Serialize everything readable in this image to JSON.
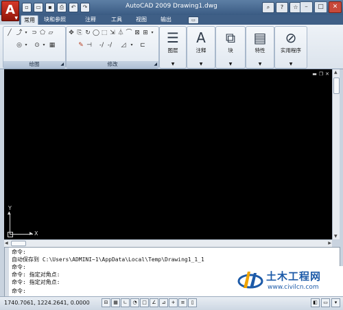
{
  "window": {
    "title": "AutoCAD 2009  Drawing1.dwg",
    "qat": [
      "new-icon",
      "open-icon",
      "save-icon",
      "print-icon",
      "undo-icon",
      "redo-icon"
    ],
    "title_tools": [
      "search-icon",
      "help-icon",
      "star-icon"
    ],
    "controls": [
      "minimize",
      "maximize",
      "close"
    ]
  },
  "tabs": [
    {
      "label": "常用",
      "active": true
    },
    {
      "label": "块和参照",
      "active": false
    },
    {
      "label": "注释",
      "active": false
    },
    {
      "label": "工具",
      "active": false
    },
    {
      "label": "视图",
      "active": false
    },
    {
      "label": "输出",
      "active": false
    }
  ],
  "ribbon": {
    "draw_title": "绘图",
    "modify_title": "修改",
    "big_panels": [
      {
        "label": "图层",
        "icon": "layers-icon"
      },
      {
        "label": "注释",
        "icon": "annotation-icon"
      },
      {
        "label": "块",
        "icon": "block-icon"
      },
      {
        "label": "特性",
        "icon": "properties-icon"
      },
      {
        "label": "实用程序",
        "icon": "utilities-icon"
      }
    ]
  },
  "drawing": {
    "ucs_x": "X",
    "ucs_y": "Y"
  },
  "command": {
    "lines": [
      "命令:",
      "自动保存到 C:\\Users\\ADMINI~1\\AppData\\Local\\Temp\\Drawing1_1_1",
      "命令:",
      "命令: 指定对角点:",
      "命令: 指定对角点:",
      "命令:"
    ]
  },
  "status": {
    "coords": "1740.7061, 1224.2641, 0.0000"
  },
  "watermark": {
    "brand": "土木工程网",
    "url": "www.civilcn.com"
  },
  "colors": {
    "title_bar": "#3a5b83",
    "drawing_bg": "#000000",
    "logo_red": "#c62a1a",
    "watermark_blue": "#1c5aa8"
  }
}
